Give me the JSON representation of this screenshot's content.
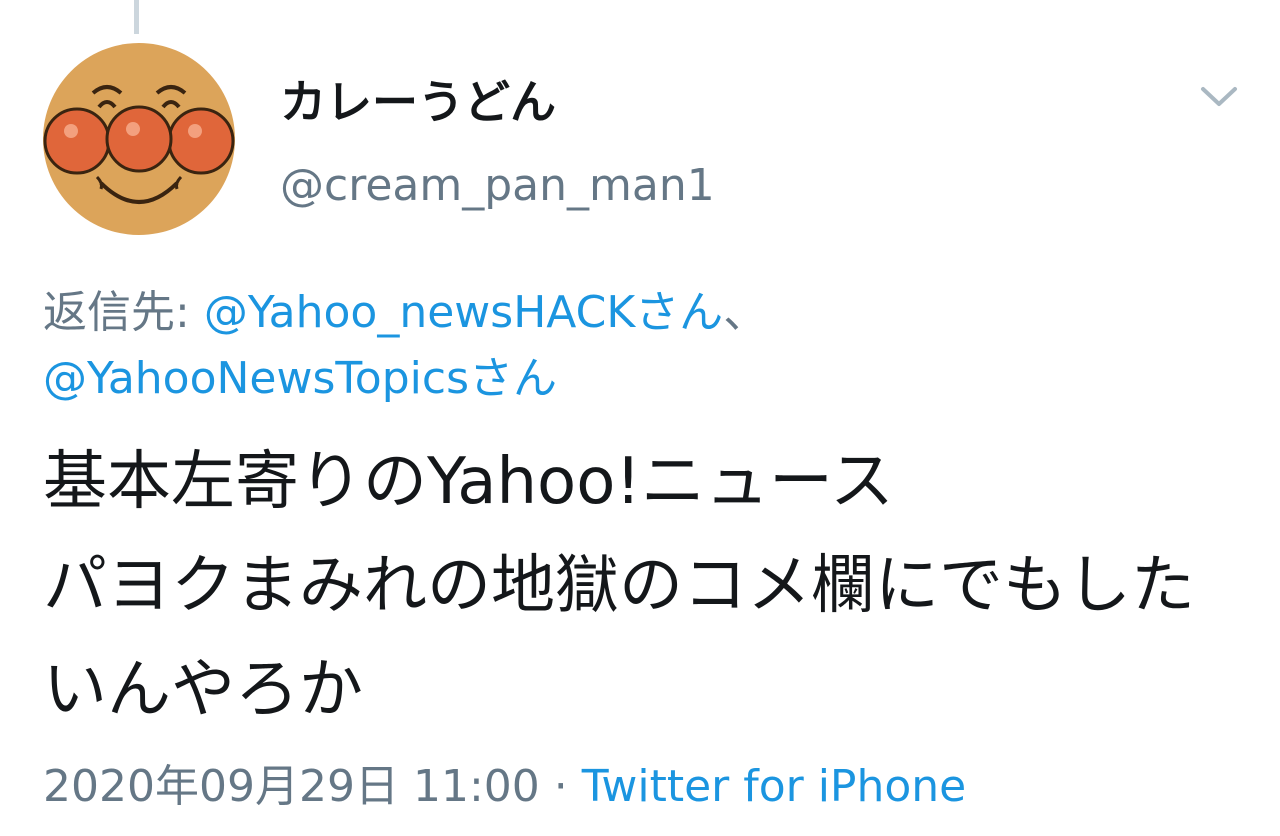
{
  "user": {
    "display_name": "カレーうどん",
    "handle": "@cream_pan_man1"
  },
  "reply": {
    "prefix": "返信先: ",
    "mention_1": "@Yahoo_newsHACKさん",
    "separator": "、",
    "mention_2": "@YahooNewsTopicsさん"
  },
  "tweet": {
    "text": "基本左寄りのYahoo!ニュース\nパヨクまみれの地獄のコメ欄にでもしたいんやろか"
  },
  "meta": {
    "date": "2020年09月29日",
    "time": "11:00",
    "dot": "·",
    "source": "Twitter for iPhone"
  },
  "icons": {
    "more": "chevron-down-icon",
    "avatar": "anpanman-face-avatar"
  },
  "colors": {
    "link": "#1b95e0",
    "secondary_text": "#657786",
    "primary_text": "#14171a",
    "thread_line": "#ccd6dd"
  }
}
